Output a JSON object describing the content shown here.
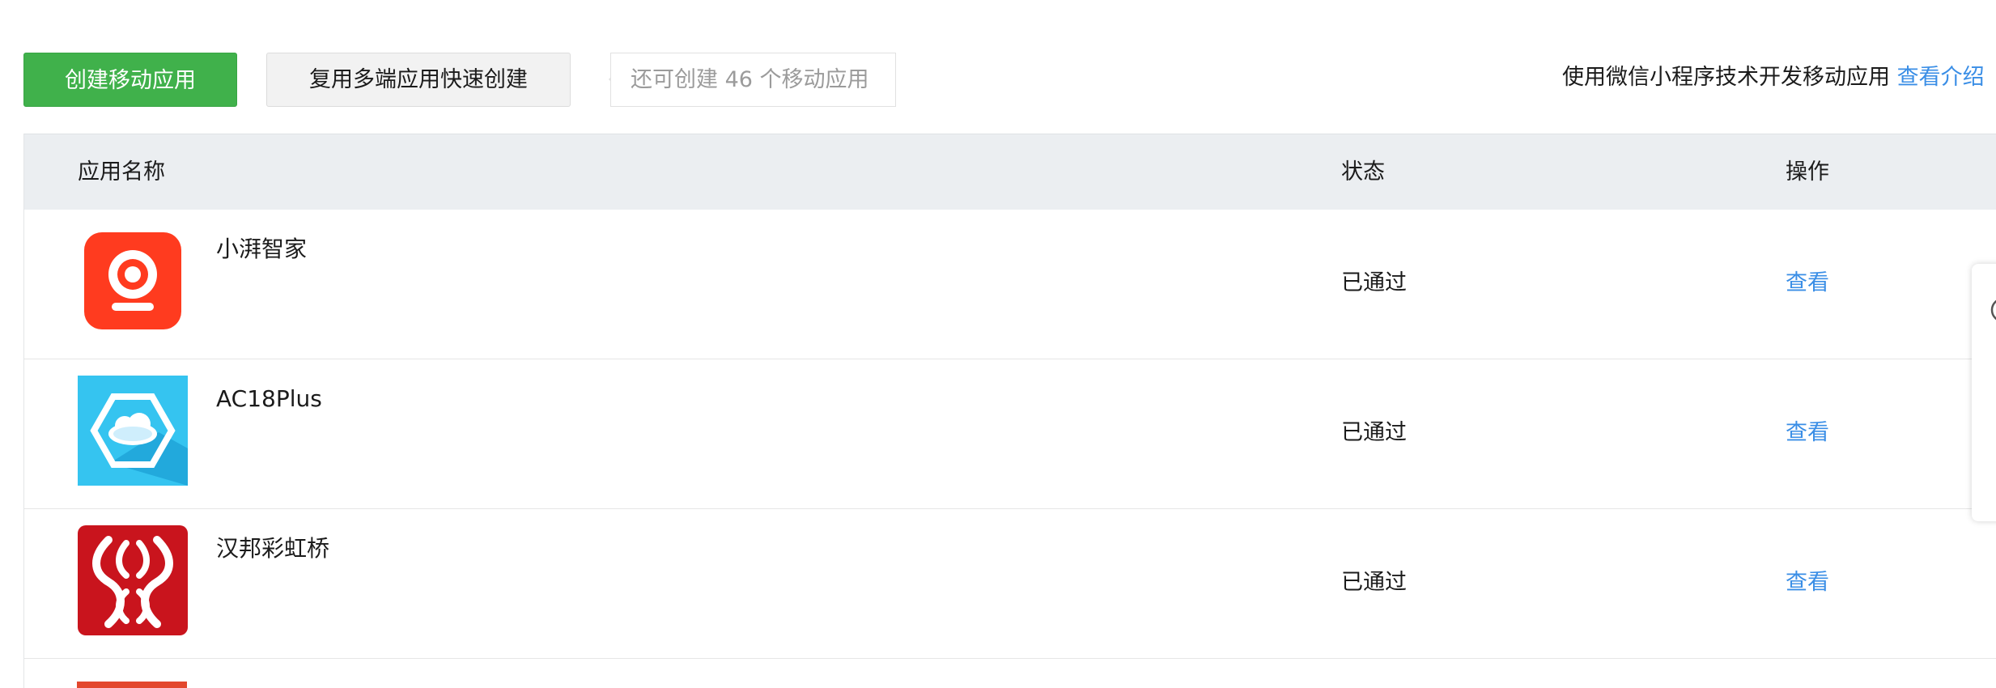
{
  "toolbar": {
    "create_label": "创建移动应用",
    "reuse_label": "复用多端应用快速创建",
    "remaining_tip": "还可创建 46 个移动应用",
    "intro_text": "使用微信小程序技术开发移动应用",
    "intro_link": "查看介绍"
  },
  "table": {
    "headers": {
      "name": "应用名称",
      "status": "状态",
      "action": "操作"
    },
    "rows": [
      {
        "name": "小湃智家",
        "status": "已通过",
        "action": "查看",
        "icon": "camera-app-icon",
        "icon_color": "#ff3b1f"
      },
      {
        "name": "AC18Plus",
        "status": "已通过",
        "action": "查看",
        "icon": "cloud-hexagon-app-icon",
        "icon_color": "#35c4f0"
      },
      {
        "name": "汉邦彩虹桥",
        "status": "已通过",
        "action": "查看",
        "icon": "waves-app-icon",
        "icon_color": "#c9141d"
      }
    ]
  },
  "colors": {
    "primary_green": "#40b14b",
    "link_blue": "#3a8ee6",
    "header_bg": "#ebeef1"
  }
}
